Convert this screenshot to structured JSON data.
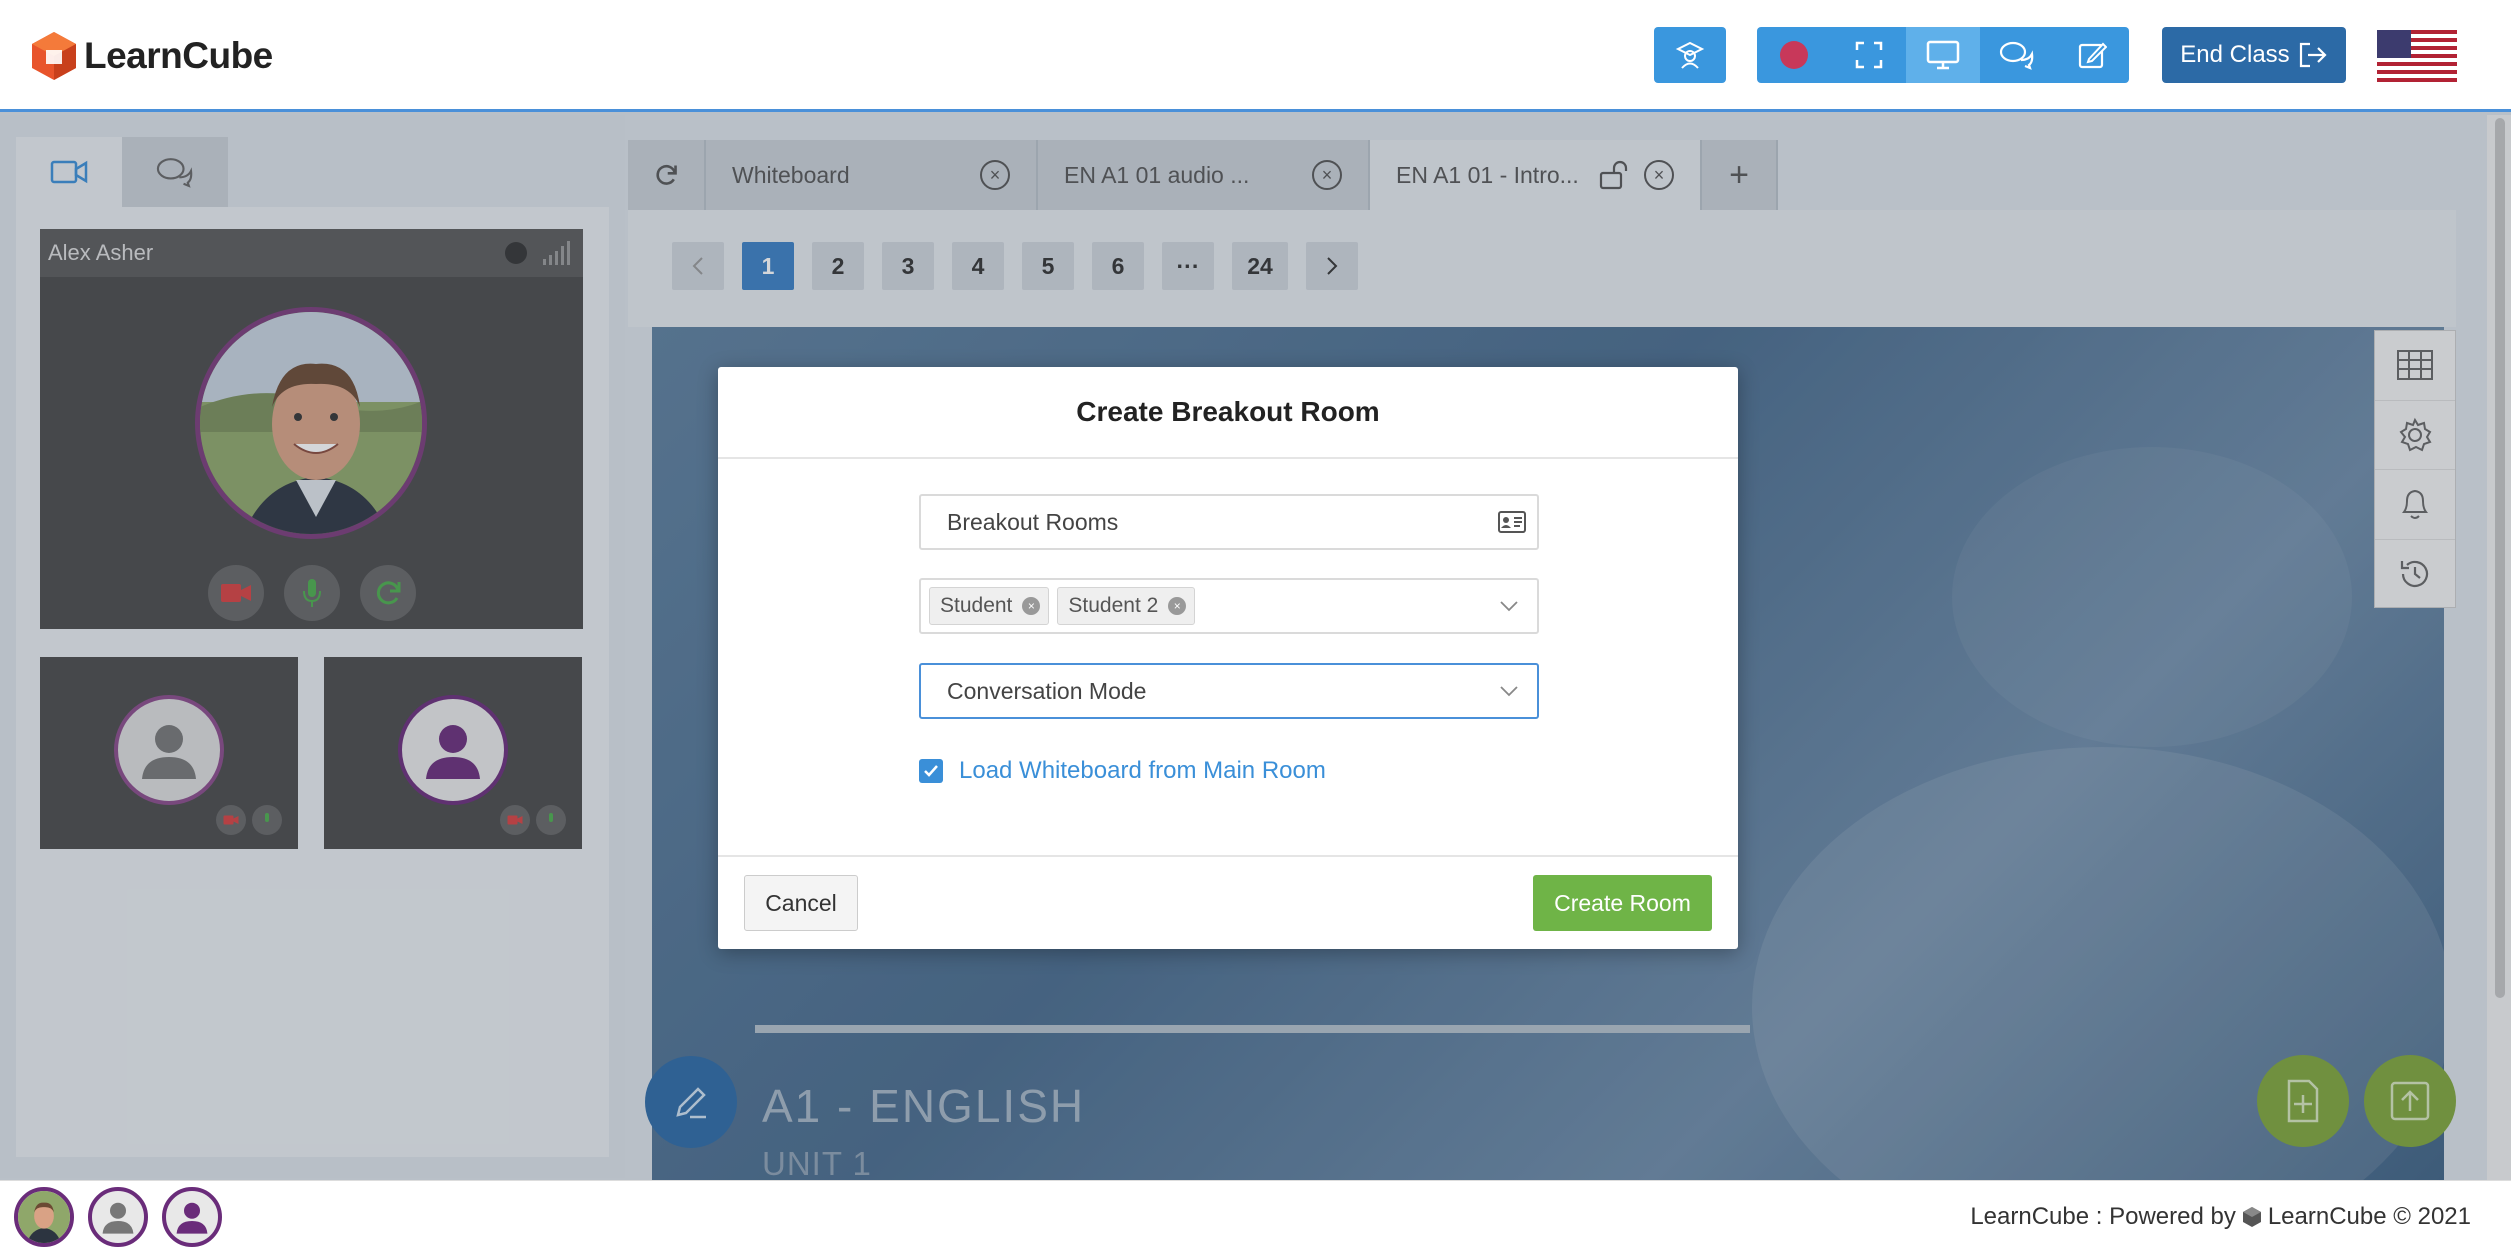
{
  "app": {
    "brand": "LearnCube"
  },
  "header": {
    "end_class_label": "End Class"
  },
  "left_panel": {
    "tabs": [
      "video-tab",
      "chat-tab"
    ],
    "main_participant": {
      "name": "Alex Asher"
    }
  },
  "doc_tabs": [
    {
      "label": "Whiteboard"
    },
    {
      "label": "EN A1 01 audio ..."
    },
    {
      "label": "EN A1 01 - Intro..."
    }
  ],
  "pagination": {
    "pages": [
      "1",
      "2",
      "3",
      "4",
      "5",
      "6",
      "···",
      "24"
    ],
    "current": "1"
  },
  "slide": {
    "title": "A1 - ENGLISH",
    "subtitle": "UNIT 1"
  },
  "modal": {
    "title": "Create Breakout Room",
    "name_field_value": "Breakout Rooms",
    "participants": [
      "Student",
      "Student 2"
    ],
    "mode_value": "Conversation Mode",
    "checkbox_label": "Load Whiteboard from Main Room",
    "checkbox_checked": true,
    "cancel_label": "Cancel",
    "create_label": "Create Room"
  },
  "footer": {
    "text_left": "LearnCube : Powered by",
    "text_right": "LearnCube © 2021"
  },
  "colors": {
    "primary": "#3a97de",
    "end_class": "#2c6aa6",
    "create": "#6fb447",
    "link": "#3a8fd8"
  }
}
